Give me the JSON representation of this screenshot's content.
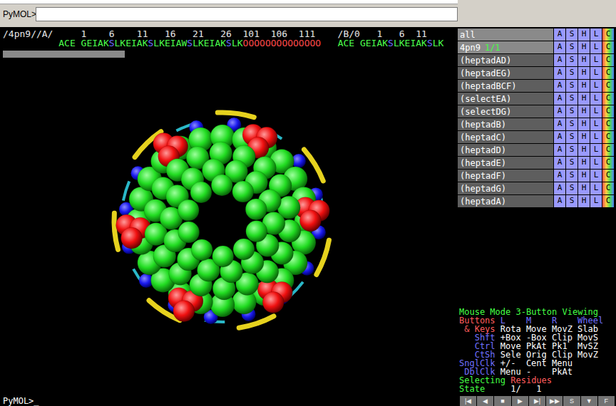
{
  "command": {
    "prompt": "PyMOL>",
    "value": ""
  },
  "sequence": {
    "ruler": "/4pn9//A/     1    6    11   16   21   26  101  106  111    /B/0   1   6  11",
    "segments": [
      {
        "text": "ACE GEIAK",
        "color": "#4cff4c"
      },
      {
        "text": "S",
        "color": "#6a6aff"
      },
      {
        "text": "LKEIAK",
        "color": "#4cff4c"
      },
      {
        "text": "S",
        "color": "#6a6aff"
      },
      {
        "text": "LKEIAW",
        "color": "#4cff4c"
      },
      {
        "text": "S",
        "color": "#6a6aff"
      },
      {
        "text": "LKEIAK",
        "color": "#4cff4c"
      },
      {
        "text": "S",
        "color": "#6a6aff"
      },
      {
        "text": "LK",
        "color": "#4cff4c"
      },
      {
        "text": "OOOOOOOOOOOOOO",
        "color": "#ff4a4a"
      },
      {
        "text": "   ACE GEIAK",
        "color": "#4cff4c"
      },
      {
        "text": "S",
        "color": "#6a6aff"
      },
      {
        "text": "LKEIAK",
        "color": "#4cff4c"
      },
      {
        "text": "S",
        "color": "#6a6aff"
      },
      {
        "text": "LK",
        "color": "#4cff4c"
      }
    ],
    "scrollbar": {
      "level": 0.27
    }
  },
  "objects": {
    "buttons": [
      "A",
      "S",
      "H",
      "L",
      "C"
    ],
    "items": [
      {
        "name": "all",
        "enabled": true
      },
      {
        "name": "4pn9",
        "state": "1/1",
        "enabled": true
      },
      {
        "name": "(heptadAD)",
        "enabled": false
      },
      {
        "name": "(heptadEG)",
        "enabled": false
      },
      {
        "name": "(heptadBCF)",
        "enabled": false
      },
      {
        "name": "(selectEA)",
        "enabled": false
      },
      {
        "name": "(selectDG)",
        "enabled": false
      },
      {
        "name": "(heptadB)",
        "enabled": false
      },
      {
        "name": "(heptadC)",
        "enabled": false
      },
      {
        "name": "(heptadD)",
        "enabled": false
      },
      {
        "name": "(heptadE)",
        "enabled": false
      },
      {
        "name": "(heptadF)",
        "enabled": false
      },
      {
        "name": "(heptadG)",
        "enabled": false
      },
      {
        "name": "(heptadA)",
        "enabled": false
      }
    ]
  },
  "mouse_mode": {
    "title": "Mouse Mode 3-Button Viewing",
    "rows": [
      {
        "label": "Buttons",
        "color": "#ff5c5c",
        "kind": "header",
        "cells": [
          "L",
          "M",
          "R",
          "Wheel"
        ]
      },
      {
        "label": "& Keys",
        "color": "#ff5c5c",
        "kind": "binding",
        "cells": [
          "Rota",
          "Move",
          "MovZ",
          "Slab"
        ]
      },
      {
        "label": "Shft",
        "color": "#7070ff",
        "kind": "binding",
        "cells": [
          "+Box",
          "-Box",
          "Clip",
          "MovS"
        ]
      },
      {
        "label": "Ctrl",
        "color": "#7070ff",
        "kind": "binding",
        "cells": [
          "Move",
          "PkAt",
          "Pk1",
          "MvSZ"
        ]
      },
      {
        "label": "CtSh",
        "color": "#7070ff",
        "kind": "binding",
        "cells": [
          "Sele",
          "Orig",
          "Clip",
          "MovZ"
        ]
      },
      {
        "label": "SnglClk",
        "color": "#7070ff",
        "kind": "binding",
        "cells": [
          "+/-",
          "Cent",
          "Menu"
        ]
      },
      {
        "label": "DblClk",
        "color": "#7070ff",
        "kind": "binding",
        "cells": [
          "Menu",
          "-",
          "PkAt"
        ]
      }
    ],
    "selecting": {
      "label": "Selecting",
      "value": "Residues"
    },
    "state": {
      "label": "State",
      "value": "1/",
      "total": "1"
    }
  },
  "console": {
    "prompt": "PyMOL>_"
  },
  "movie_controls": [
    "|◀",
    "◀",
    "■",
    "▶",
    "▶|",
    "▶▶",
    "S",
    "▼",
    "F"
  ]
}
